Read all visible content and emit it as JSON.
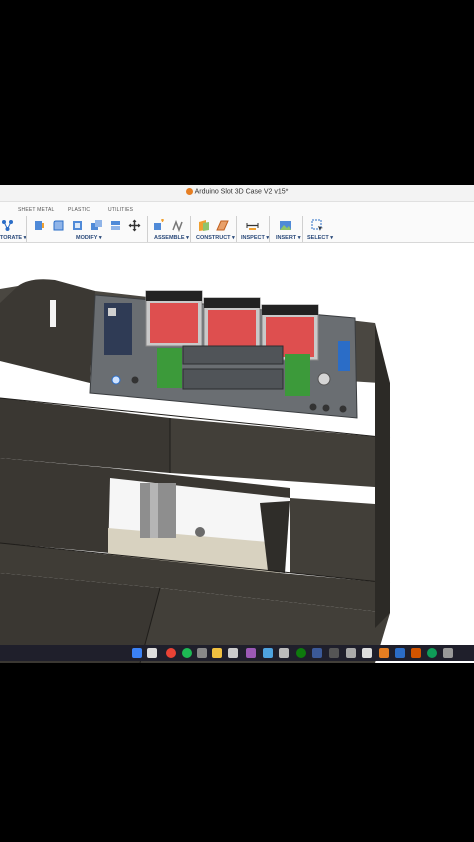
{
  "window": {
    "title": "Arduino Slot 3D Case V2 v15*"
  },
  "ribbon": {
    "tabs": [
      "SHEET METAL",
      "PLASTIC",
      "UTILITIES"
    ],
    "groups": [
      "TORATE ▾",
      "MODIFY ▾",
      "ASSEMBLE ▾",
      "CONSTRUCT ▾",
      "INSPECT ▾",
      "INSERT ▾",
      "SELECT ▾"
    ]
  },
  "icons": {
    "taskbar": [
      "windows-icon",
      "search-icon",
      "chrome-icon",
      "edge-icon",
      "spotify-icon",
      "media-icon",
      "files-icon",
      "app-icon",
      "premiere-icon",
      "photos-icon",
      "xbox-icon",
      "settings-icon",
      "browser-icon",
      "app2-icon",
      "app3-icon",
      "fusion-icon",
      "mail-icon",
      "edge2-icon",
      "app4-icon"
    ]
  },
  "colors": {
    "case_dark": "#3d3a35",
    "case_mid": "#55524b",
    "pcb": "#5a5e62",
    "led_red": "#e23a3a",
    "green_button": "#3c9a3a",
    "accent_blue": "#2b6dc7"
  }
}
